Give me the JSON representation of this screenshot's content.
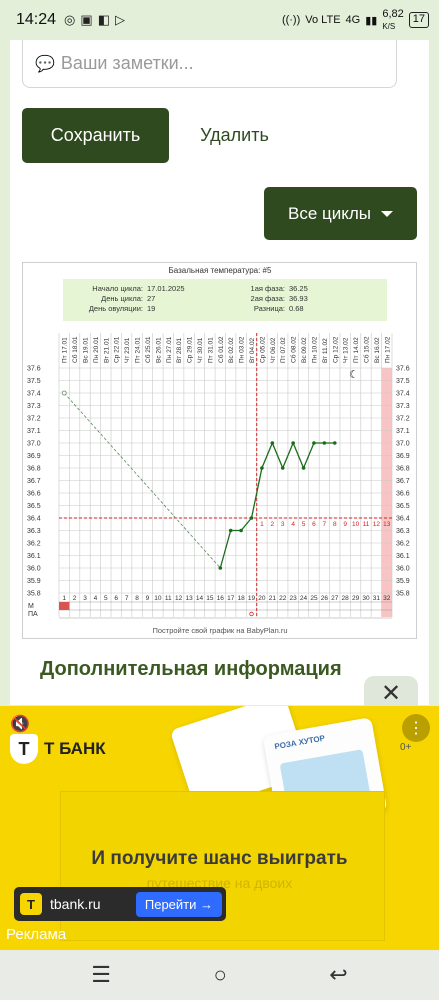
{
  "status_bar": {
    "time": "14:24",
    "network_speed": "6,82",
    "network_unit": "K/S",
    "network_type": "4G",
    "signal_label": "Vo LTE",
    "battery": "17"
  },
  "notes": {
    "placeholder": "Ваши заметки..."
  },
  "buttons": {
    "save": "Сохранить",
    "delete": "Удалить",
    "all_cycles": "Все циклы"
  },
  "chart_data": {
    "type": "line",
    "title": "Базальная температура: #5",
    "info": {
      "cycle_start_label": "Начало цикла:",
      "cycle_start": "17.01.2025",
      "cycle_day_label": "День цикла:",
      "cycle_day": "27",
      "ovulation_day_label": "День овуляции:",
      "ovulation_day": "19",
      "phase1_label": "1ая фаза:",
      "phase1": "36.25",
      "phase2_label": "2ая фаза:",
      "phase2": "36.93",
      "difference_label": "Разница:",
      "difference": "0.68"
    },
    "dates": [
      "Пт 17.01",
      "Сб 18.01",
      "Вс 19.01",
      "Пн 20.01",
      "Вт 21.01",
      "Ср 22.01",
      "Чт 23.01",
      "Пт 24.01",
      "Сб 25.01",
      "Вс 26.01",
      "Пн 27.01",
      "Вт 28.01",
      "Ср 29.01",
      "Чт 30.01",
      "Пт 31.01",
      "Сб 01.02",
      "Вс 02.02",
      "Пн 03.02",
      "Вт 04.02",
      "Ср 05.02",
      "Чт 06.02",
      "Пт 07.02",
      "Сб 08.02",
      "Вс 09.02",
      "Пн 10.02",
      "Вт 11.02",
      "Ср 12.02",
      "Чт 13.02",
      "Пт 14.02",
      "Сб 15.02",
      "Вс 16.02",
      "Пн 17.02"
    ],
    "days": [
      1,
      2,
      3,
      4,
      5,
      6,
      7,
      8,
      9,
      10,
      11,
      12,
      13,
      14,
      15,
      16,
      17,
      18,
      19,
      20,
      21,
      22,
      23,
      24,
      25,
      26,
      27,
      28,
      29,
      30,
      31,
      32
    ],
    "y_ticks": [
      "37.6",
      "37.5",
      "37.4",
      "37.3",
      "37.2",
      "37.1",
      "37.0",
      "36.9",
      "36.8",
      "36.7",
      "36.6",
      "36.5",
      "36.4",
      "36.3",
      "36.2",
      "36.1",
      "36.0",
      "35.9",
      "35.8"
    ],
    "ylim": [
      35.8,
      37.6
    ],
    "first_point": {
      "day": 1,
      "temp": 37.4
    },
    "dashed_to": {
      "day": 16,
      "temp": 36.0
    },
    "series": [
      {
        "values": [
          [
            16,
            36.0
          ],
          [
            17,
            36.3
          ],
          [
            18,
            36.3
          ],
          [
            19,
            36.4
          ],
          [
            20,
            36.8
          ],
          [
            21,
            37.0
          ],
          [
            22,
            36.8
          ],
          [
            23,
            37.0
          ],
          [
            24,
            36.8
          ],
          [
            25,
            37.0
          ],
          [
            26,
            37.0
          ],
          [
            27,
            37.0
          ]
        ]
      }
    ],
    "coverline": 36.4,
    "ovulation_day_marker": 19,
    "phase2_numbers": [
      "1",
      "2",
      "3",
      "4",
      "5",
      "6",
      "7",
      "8",
      "9",
      "10",
      "11",
      "12",
      "13"
    ],
    "row_labels": [
      "М",
      "ПА"
    ],
    "period_days": [
      1
    ],
    "intercourse_days": [
      19
    ],
    "footer": "Постройте свой график на BabyPlan.ru",
    "colors": {
      "line": "#1a6e1a",
      "coverline": "#d62020",
      "grid": "#c8c8c8",
      "info_bg": "#e6f6d4",
      "highlight_col": "#f8c4c4",
      "period": "#d9534f"
    }
  },
  "section_title": "Дополнительная информация",
  "ad": {
    "brand": "Т БАНК",
    "headline": "И получите шанс выиграть",
    "subline": "путешествие на двоих",
    "url": "tbank.ru",
    "cta": "Перейти →",
    "label": "Реклама",
    "age": "0+",
    "ticket_brand": "РОЗА ХУТОР",
    "colors": {
      "bg": "#f7d500",
      "cta": "#2f6bff"
    }
  },
  "icons": {
    "close": "close-icon",
    "menu": "menu-icon",
    "home": "home-icon",
    "back": "back-icon",
    "more": "more-vert-icon"
  }
}
